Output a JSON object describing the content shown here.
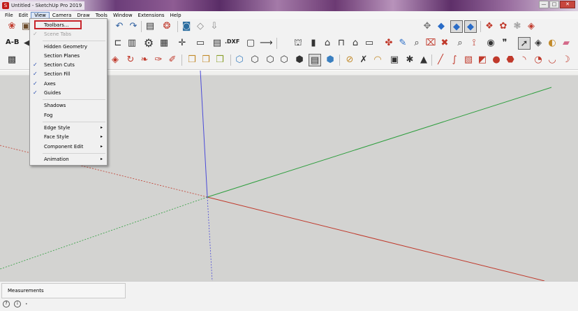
{
  "window": {
    "title": "Untitled - SketchUp Pro 2019",
    "buttons": [
      "—",
      "□",
      "✕"
    ]
  },
  "menubar": [
    "File",
    "Edit",
    "View",
    "Camera",
    "Draw",
    "Tools",
    "Window",
    "Extensions",
    "Help"
  ],
  "active_menu": "View",
  "view_menu": {
    "toolbars": "Toolbars...",
    "scene_tabs": "Scene Tabs",
    "hidden_geometry": "Hidden Geometry",
    "section_planes": "Section Planes",
    "section_cuts": "Section Cuts",
    "section_fill": "Section Fill",
    "axes": "Axes",
    "guides": "Guides",
    "shadows": "Shadows",
    "fog": "Fog",
    "edge_style": "Edge Style",
    "face_style": "Face Style",
    "component_edit": "Component Edit",
    "animation": "Animation",
    "checkmark": "✓",
    "submenu_arrow": "▸"
  },
  "toolbar": {
    "ab_label": "A-B",
    "dxf_label": ".DXF",
    "icons": [
      "tape-measure-icon",
      "undo-icon",
      "redo-icon",
      "print-icon",
      "select-icon",
      "orbit-icon",
      "pan-icon",
      "zoom-icon",
      "paint-icon",
      "eraser-icon"
    ]
  },
  "statusbar": {
    "measurements_label": "Measurements",
    "help_icon": "?",
    "info_icon": "i"
  },
  "colors": {
    "red_axis": "#c0392b",
    "green_axis": "#2e9e3e",
    "blue_axis": "#4a4ad8",
    "highlight": "#c8252c"
  }
}
